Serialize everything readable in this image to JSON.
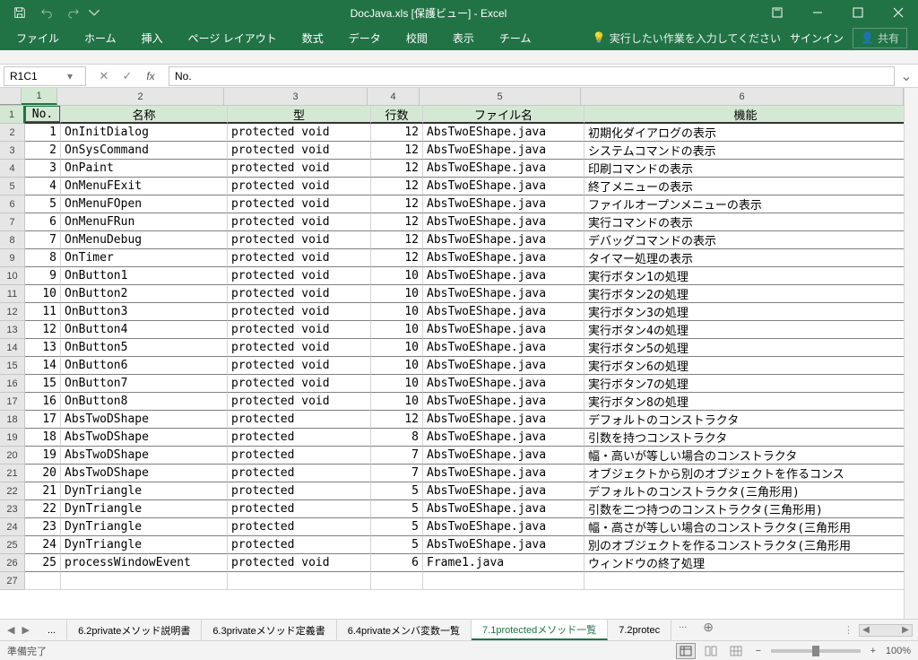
{
  "title": "DocJava.xls  [保護ビュー] - Excel",
  "qat": {
    "save": "save",
    "undo": "undo",
    "redo": "redo"
  },
  "ribbon_tabs": [
    "ファイル",
    "ホーム",
    "挿入",
    "ページ レイアウト",
    "数式",
    "データ",
    "校閲",
    "表示",
    "チーム"
  ],
  "tell_me": "実行したい作業を入力してください",
  "signin": "サインイン",
  "share": "共有",
  "name_box": "R1C1",
  "formula": "No.",
  "col_headers": [
    "1",
    "2",
    "3",
    "4",
    "5",
    "6"
  ],
  "table_headers": {
    "no": "No.",
    "name": "名称",
    "type": "型",
    "lines": "行数",
    "file": "ファイル名",
    "func": "機能"
  },
  "rows": [
    {
      "no": "1",
      "name": "OnInitDialog",
      "type": "protected void",
      "lines": "12",
      "file": "AbsTwoEShape.java",
      "func": "初期化ダイアログの表示"
    },
    {
      "no": "2",
      "name": "OnSysCommand",
      "type": "protected void",
      "lines": "12",
      "file": "AbsTwoEShape.java",
      "func": "システムコマンドの表示"
    },
    {
      "no": "3",
      "name": "OnPaint",
      "type": "protected void",
      "lines": "12",
      "file": "AbsTwoEShape.java",
      "func": "印刷コマンドの表示"
    },
    {
      "no": "4",
      "name": "OnMenuFExit",
      "type": "protected void",
      "lines": "12",
      "file": "AbsTwoEShape.java",
      "func": "終了メニューの表示"
    },
    {
      "no": "5",
      "name": "OnMenuFOpen",
      "type": "protected void",
      "lines": "12",
      "file": "AbsTwoEShape.java",
      "func": "ファイルオープンメニューの表示"
    },
    {
      "no": "6",
      "name": "OnMenuFRun",
      "type": "protected void",
      "lines": "12",
      "file": "AbsTwoEShape.java",
      "func": "実行コマンドの表示"
    },
    {
      "no": "7",
      "name": "OnMenuDebug",
      "type": "protected void",
      "lines": "12",
      "file": "AbsTwoEShape.java",
      "func": "デバッグコマンドの表示"
    },
    {
      "no": "8",
      "name": "OnTimer",
      "type": "protected void",
      "lines": "12",
      "file": "AbsTwoEShape.java",
      "func": "タイマー処理の表示"
    },
    {
      "no": "9",
      "name": "OnButton1",
      "type": "protected void",
      "lines": "10",
      "file": "AbsTwoEShape.java",
      "func": "実行ボタン1の処理"
    },
    {
      "no": "10",
      "name": "OnButton2",
      "type": "protected void",
      "lines": "10",
      "file": "AbsTwoEShape.java",
      "func": "実行ボタン2の処理"
    },
    {
      "no": "11",
      "name": "OnButton3",
      "type": "protected void",
      "lines": "10",
      "file": "AbsTwoEShape.java",
      "func": "実行ボタン3の処理"
    },
    {
      "no": "12",
      "name": "OnButton4",
      "type": "protected void",
      "lines": "10",
      "file": "AbsTwoEShape.java",
      "func": "実行ボタン4の処理"
    },
    {
      "no": "13",
      "name": "OnButton5",
      "type": "protected void",
      "lines": "10",
      "file": "AbsTwoEShape.java",
      "func": "実行ボタン5の処理"
    },
    {
      "no": "14",
      "name": "OnButton6",
      "type": "protected void",
      "lines": "10",
      "file": "AbsTwoEShape.java",
      "func": "実行ボタン6の処理"
    },
    {
      "no": "15",
      "name": "OnButton7",
      "type": "protected void",
      "lines": "10",
      "file": "AbsTwoEShape.java",
      "func": "実行ボタン7の処理"
    },
    {
      "no": "16",
      "name": "OnButton8",
      "type": "protected void",
      "lines": "10",
      "file": "AbsTwoEShape.java",
      "func": "実行ボタン8の処理"
    },
    {
      "no": "17",
      "name": "AbsTwoDShape",
      "type": "protected",
      "lines": "12",
      "file": "AbsTwoEShape.java",
      "func": "デフォルトのコンストラクタ"
    },
    {
      "no": "18",
      "name": "AbsTwoDShape",
      "type": "protected",
      "lines": "8",
      "file": "AbsTwoEShape.java",
      "func": "引数を持つコンストラクタ"
    },
    {
      "no": "19",
      "name": "AbsTwoDShape",
      "type": "protected",
      "lines": "7",
      "file": "AbsTwoEShape.java",
      "func": "幅・高いが等しい場合のコンストラクタ"
    },
    {
      "no": "20",
      "name": "AbsTwoDShape",
      "type": "protected",
      "lines": "7",
      "file": "AbsTwoEShape.java",
      "func": "オブジェクトから別のオブジェクトを作るコンス"
    },
    {
      "no": "21",
      "name": "DynTriangle",
      "type": "protected",
      "lines": "5",
      "file": "AbsTwoEShape.java",
      "func": "デフォルトのコンストラクタ(三角形用)"
    },
    {
      "no": "22",
      "name": "DynTriangle",
      "type": "protected",
      "lines": "5",
      "file": "AbsTwoEShape.java",
      "func": "引数を二つ持つのコンストラクタ(三角形用)"
    },
    {
      "no": "23",
      "name": "DynTriangle",
      "type": "protected",
      "lines": "5",
      "file": "AbsTwoEShape.java",
      "func": "幅・高さが等しい場合のコンストラクタ(三角形用"
    },
    {
      "no": "24",
      "name": "DynTriangle",
      "type": "protected",
      "lines": "5",
      "file": "AbsTwoEShape.java",
      "func": "別のオブジェクトを作るコンストラクタ(三角形用"
    },
    {
      "no": "25",
      "name": "processWindowEvent",
      "type": "protected void",
      "lines": "6",
      "file": "Frame1.java",
      "func": "ウィンドウの終了処理"
    }
  ],
  "sheet_tabs": {
    "ellipsis": "...",
    "t1": "6.2privateメソッド説明書",
    "t2": "6.3privateメソッド定義書",
    "t3": "6.4privateメンバ変数一覧",
    "t4": "7.1protectedメソッド一覧",
    "t5": "7.2protec",
    "more": "..."
  },
  "status_text": "準備完了",
  "zoom": "100%"
}
